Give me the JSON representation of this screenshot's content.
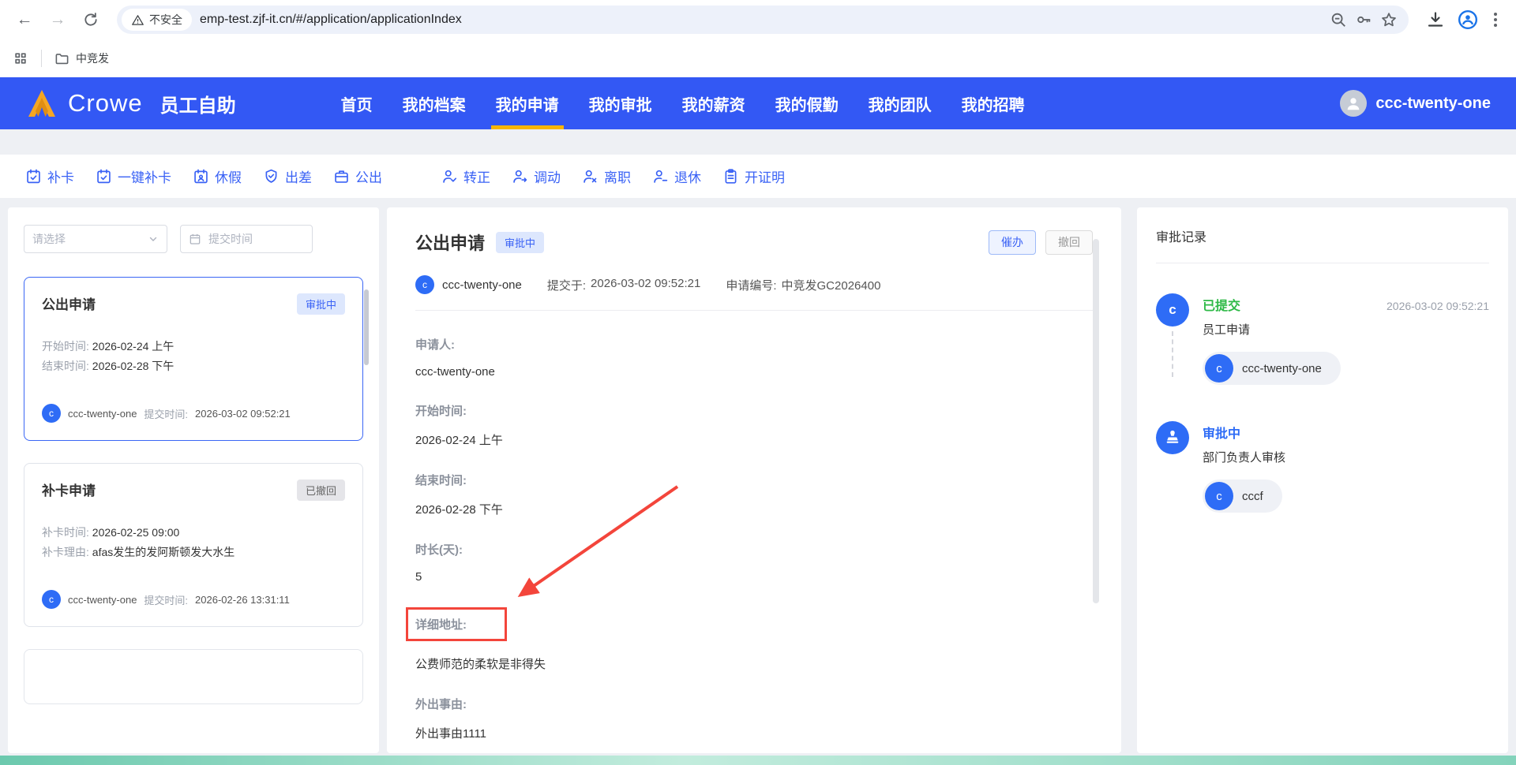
{
  "browser": {
    "url": "emp-test.zjf-it.cn/#/application/applicationIndex",
    "security_label": "不安全",
    "bookmarks": {
      "folder_label": "中竞发"
    }
  },
  "icons": {
    "back": "←",
    "forward": "→",
    "reload": "circular-arrow",
    "warning": "triangle-alert",
    "zoom_out": "magnifier-minus",
    "key": "key",
    "star": "star-outline",
    "download": "down-arrow-tray",
    "profile": "person-circle",
    "menu": "kebab-dots",
    "apps_grid": "grid-squares",
    "folder": "folder-outline",
    "chevron_down": "chevron-down",
    "calendar": "calendar-outline",
    "check": "checkmark",
    "stamp": "stamp"
  },
  "header": {
    "brand": "Crowe",
    "app_title": "员工自助",
    "nav": [
      "首页",
      "我的档案",
      "我的申请",
      "我的审批",
      "我的薪资",
      "我的假勤",
      "我的团队",
      "我的招聘"
    ],
    "user_name": "ccc-twenty-one"
  },
  "toolbar": {
    "items": [
      "补卡",
      "一键补卡",
      "休假",
      "出差",
      "公出",
      "转正",
      "调动",
      "离职",
      "退休",
      "开证明"
    ]
  },
  "sidebar": {
    "type_filter_placeholder": "请选择",
    "date_filter_placeholder": "提交时间",
    "cards": [
      {
        "title": "公出申请",
        "status": "审批中",
        "rows": [
          {
            "label": "开始时间:",
            "value": "2026-02-24 上午"
          },
          {
            "label": "结束时间:",
            "value": "2026-02-28 下午"
          }
        ],
        "avatar": "c",
        "submitter": "ccc-twenty-one",
        "submit_label": "提交时间:",
        "submit_time": "2026-03-02 09:52:21"
      },
      {
        "title": "补卡申请",
        "status": "已撤回",
        "rows": [
          {
            "label": "补卡时间:",
            "value": "2026-02-25 09:00"
          },
          {
            "label": "补卡理由:",
            "value": "afas发生的发阿斯顿发大水生"
          }
        ],
        "avatar": "c",
        "submitter": "ccc-twenty-one",
        "submit_label": "提交时间:",
        "submit_time": "2026-02-26 13:31:11"
      }
    ]
  },
  "main": {
    "title": "公出申请",
    "status": "审批中",
    "urge_label": "催办",
    "withdraw_label": "撤回",
    "avatar": "c",
    "submitter": "ccc-twenty-one",
    "submitted_label": "提交于:",
    "submitted_time": "2026-03-02 09:52:21",
    "app_no_label": "申请编号:",
    "app_no": "中竞发GC2026400",
    "fields": [
      {
        "label": "申请人:",
        "value": "ccc-twenty-one"
      },
      {
        "label": "开始时间:",
        "value": "2026-02-24 上午"
      },
      {
        "label": "结束时间:",
        "value": "2026-02-28 下午"
      },
      {
        "label": "时长(天):",
        "value": "5"
      },
      {
        "label": "详细地址:",
        "value": "公费师范的柔软是非得失"
      },
      {
        "label": "外出事由:",
        "value": "外出事由1111"
      }
    ]
  },
  "approval": {
    "title": "审批记录",
    "steps": [
      {
        "status": "已提交",
        "time": "2026-03-02 09:52:21",
        "desc": "员工申请",
        "avatar": "c",
        "person": "ccc-twenty-one"
      },
      {
        "status": "审批中",
        "time": "",
        "desc": "部门负责人审核",
        "avatar": "c",
        "person": "cccf"
      }
    ]
  },
  "colors": {
    "primary_blue": "#3358f4",
    "accent_yellow": "#f7b500",
    "link_blue": "#3a62f5",
    "avatar_blue": "#2e6cf6",
    "success_green": "#2fc14e",
    "annotation_red": "#f3453b",
    "badge_blue_bg": "#dde7fd",
    "badge_gray_bg": "#e5e5e9",
    "teal_bottom_bar": "#6cc9ae"
  }
}
